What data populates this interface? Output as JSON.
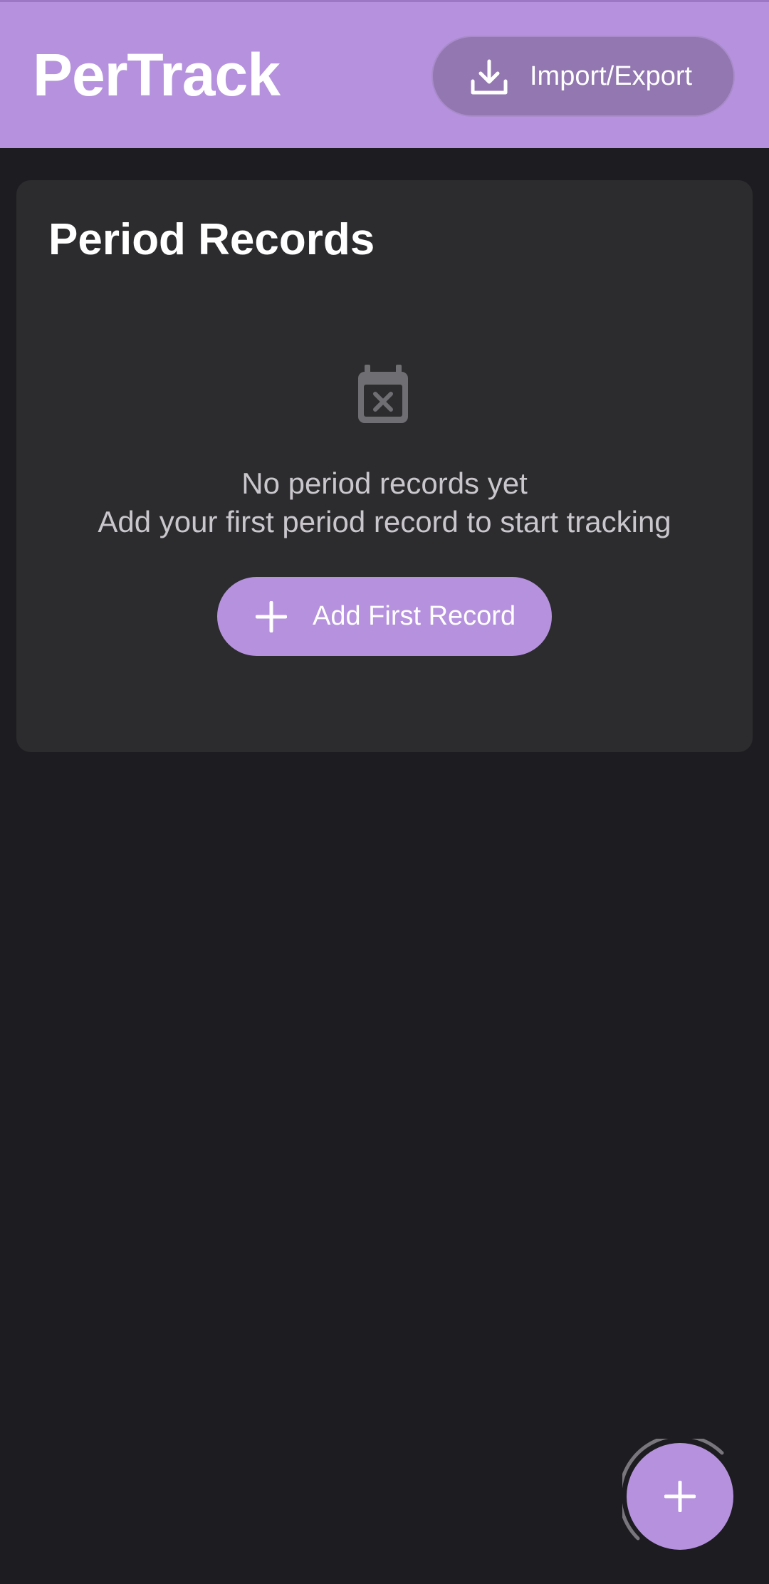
{
  "header": {
    "title": "PerTrack",
    "import_export_label": "Import/Export",
    "import_icon": "download-icon"
  },
  "records_card": {
    "title": "Period Records",
    "empty_icon": "calendar-remove-icon",
    "empty_title": "No period records yet",
    "empty_subtitle": "Add your first period record to start tracking",
    "add_first_label": "Add First Record",
    "add_icon": "plus-icon"
  },
  "fab": {
    "icon": "plus-icon"
  },
  "colors": {
    "accent": "#b692de",
    "background": "#1d1c20",
    "card": "#2c2c2f",
    "import_button": "#9277b0",
    "muted_text": "#c9c6cc",
    "empty_icon": "#6f6e72"
  }
}
